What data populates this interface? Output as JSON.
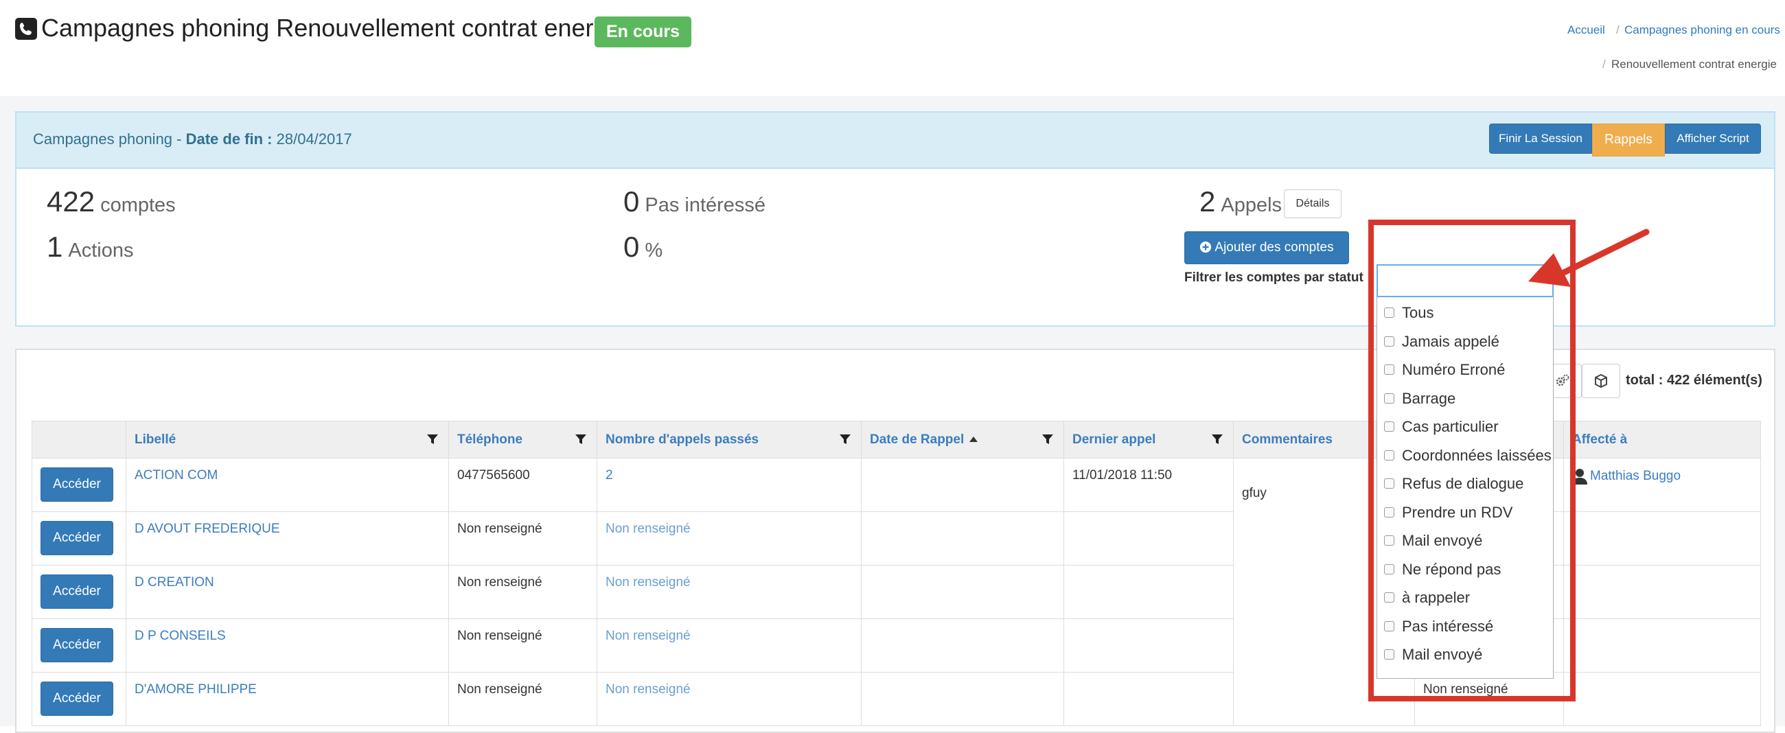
{
  "header": {
    "title": "Campagnes phoning Renouvellement contrat energie",
    "status_badge": "En cours",
    "breadcrumb": [
      "Accueil",
      "Campagnes phoning en cours",
      "Renouvellement contrat energie"
    ]
  },
  "panel": {
    "title_prefix": "Campagnes phoning - ",
    "date_label": "Date de fin :",
    "date_value": "28/04/2017",
    "buttons": [
      "Finir La Session",
      "Rappels",
      "Afficher Script"
    ]
  },
  "stats": {
    "comptes": {
      "value": "422",
      "label": "comptes"
    },
    "actions": {
      "value": "1",
      "label": "Actions"
    },
    "pas_interesse": {
      "value": "0",
      "label": "Pas intéressé"
    },
    "percent": {
      "value": "0",
      "label": "%"
    },
    "appels": {
      "value": "2",
      "label": "Appels"
    },
    "details_button": "Détails"
  },
  "add_accounts_button": "Ajouter des comptes",
  "filter_label": "Filtrer les comptes par statut :",
  "filter_dropdown": {
    "search_value": "",
    "options": [
      "Tous",
      "Jamais appelé",
      "Numéro Erroné",
      "Barrage",
      "Cas particulier",
      "Coordonnées laissées",
      "Refus de dialogue",
      "Prendre un RDV",
      "Mail envoyé",
      "Ne répond pas",
      "à rappeler",
      "Pas intéressé",
      "Mail envoyé"
    ]
  },
  "total_label": "total : 422 élément(s)",
  "table": {
    "columns": [
      "",
      "Libellé",
      "Téléphone",
      "Nombre d'appels passés",
      "Date de Rappel",
      "Dernier appel",
      "Commentaires",
      "",
      "Affecté à"
    ],
    "action_label": "Accéder",
    "rows": [
      {
        "libelle": "ACTION COM",
        "telephone": "0477565600",
        "appels": "2",
        "date_rappel": "",
        "dernier_appel": "11/01/2018 11:50",
        "commentaires": "gfuy",
        "statut": "",
        "affecte": "Matthias Buggo"
      },
      {
        "libelle": "D AVOUT FREDERIQUE",
        "telephone": "Non renseigné",
        "appels": "Non renseigné",
        "date_rappel": "",
        "dernier_appel": "",
        "commentaires": "",
        "statut": "",
        "affecte": ""
      },
      {
        "libelle": "D CREATION",
        "telephone": "Non renseigné",
        "appels": "Non renseigné",
        "date_rappel": "",
        "dernier_appel": "",
        "commentaires": "",
        "statut": "",
        "affecte": ""
      },
      {
        "libelle": "D P CONSEILS",
        "telephone": "Non renseigné",
        "appels": "Non renseigné",
        "date_rappel": "",
        "dernier_appel": "",
        "commentaires": "",
        "statut": "",
        "affecte": ""
      },
      {
        "libelle": "D'AMORE PHILIPPE",
        "telephone": "Non renseigné",
        "appels": "Non renseigné",
        "date_rappel": "",
        "dernier_appel": "",
        "commentaires": "",
        "statut": "Non renseigné",
        "affecte": ""
      }
    ]
  },
  "colors": {
    "primary": "#337ab7",
    "success": "#5cb85c",
    "warning": "#f0ad4e",
    "annotation_red": "#d9362b",
    "panel_info": "#d9edf7"
  },
  "icons": [
    "phone-icon",
    "plus-circle-icon",
    "filter-icon",
    "sort-up-icon",
    "gears-icon",
    "cube-icon",
    "user-icon",
    "arrow-annotation"
  ]
}
